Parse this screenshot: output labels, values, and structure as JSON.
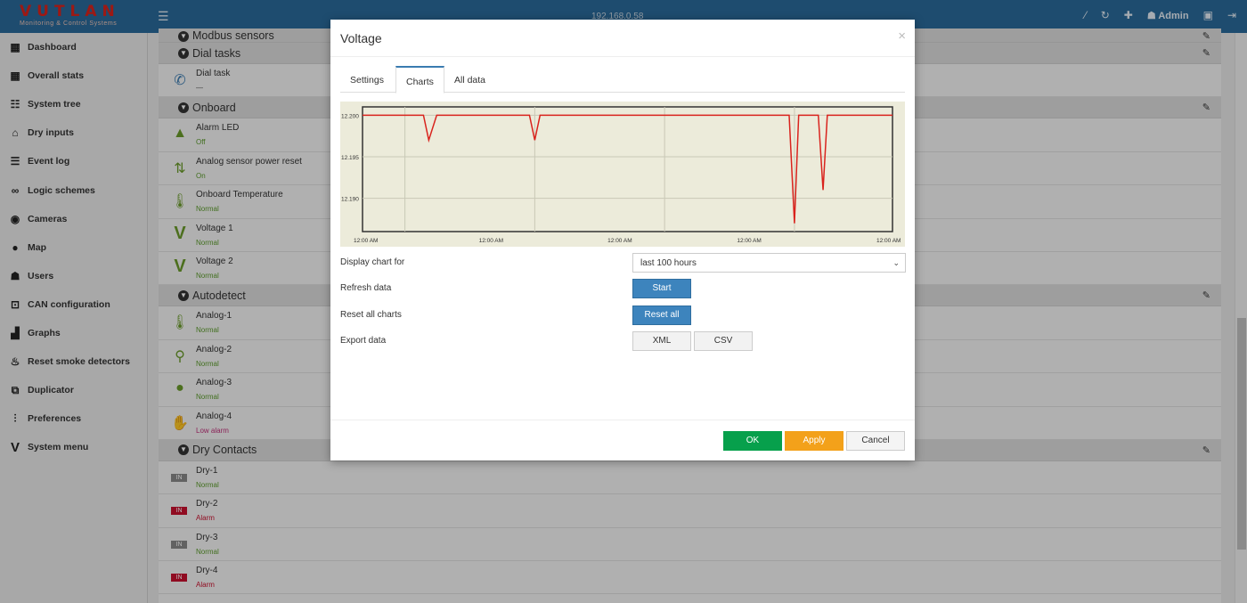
{
  "topbar": {
    "brand": "VUTLAN",
    "brand_sub": "Monitoring & Control Systems",
    "ip": "192.168.0.58",
    "user": "Admin"
  },
  "sidebar": {
    "items": [
      {
        "label": "Dashboard",
        "icon": "grid-icon"
      },
      {
        "label": "Overall stats",
        "icon": "grid-icon"
      },
      {
        "label": "System tree",
        "icon": "tree-icon"
      },
      {
        "label": "Dry inputs",
        "icon": "dry-input-icon"
      },
      {
        "label": "Event log",
        "icon": "list-icon"
      },
      {
        "label": "Logic schemes",
        "icon": "link-icon"
      },
      {
        "label": "Cameras",
        "icon": "eye-icon"
      },
      {
        "label": "Map",
        "icon": "map-marker-icon"
      },
      {
        "label": "Users",
        "icon": "user-icon"
      },
      {
        "label": "CAN configuration",
        "icon": "can-icon"
      },
      {
        "label": "Graphs",
        "icon": "bar-chart-icon"
      },
      {
        "label": "Reset smoke detectors",
        "icon": "fire-icon"
      },
      {
        "label": "Duplicator",
        "icon": "duplicate-icon"
      },
      {
        "label": "Preferences",
        "icon": "sliders-icon"
      },
      {
        "label": "System menu",
        "icon": "vutlan-v-icon"
      }
    ]
  },
  "sections": {
    "modbus": "Modbus sensors",
    "dial": "Dial tasks",
    "dial_rows": [
      {
        "name": "Dial task",
        "status": "—"
      }
    ],
    "onboard": "Onboard",
    "onboard_rows": [
      {
        "name": "Alarm LED",
        "status": "Off"
      },
      {
        "name": "Analog sensor power reset",
        "status": "On"
      },
      {
        "name": "Onboard Temperature",
        "status": "Normal"
      },
      {
        "name": "Voltage 1",
        "status": "Normal"
      },
      {
        "name": "Voltage 2",
        "status": "Normal"
      }
    ],
    "autodetect": "Autodetect",
    "autodetect_rows": [
      {
        "name": "Analog-1",
        "status": "Normal"
      },
      {
        "name": "Analog-2",
        "status": "Normal"
      },
      {
        "name": "Analog-3",
        "status": "Normal"
      },
      {
        "name": "Analog-4",
        "status": "Low alarm"
      }
    ],
    "dry": "Dry Contacts",
    "dry_rows": [
      {
        "name": "Dry-1",
        "status": "Normal",
        "badge": "IN"
      },
      {
        "name": "Dry-2",
        "status": "Alarm",
        "badge": "IN"
      },
      {
        "name": "Dry-3",
        "status": "Normal",
        "badge": "IN"
      },
      {
        "name": "Dry-4",
        "status": "Alarm",
        "badge": "IN"
      }
    ]
  },
  "modal": {
    "title": "Voltage",
    "close": "×",
    "tabs": [
      "Settings",
      "Charts",
      "All data"
    ],
    "active_tab": "Charts",
    "display_label": "Display chart for",
    "display_value": "last 100 hours",
    "refresh_label": "Refresh data",
    "start_label": "Start",
    "reset_label": "Reset all charts",
    "reset_btn": "Reset all",
    "export_label": "Export data",
    "xml_btn": "XML",
    "csv_btn": "CSV",
    "ok": "OK",
    "apply": "Apply",
    "cancel": "Cancel"
  },
  "chart_data": {
    "type": "line",
    "title": "",
    "xlabel": "",
    "ylabel": "",
    "x_ticks": [
      "12:00 AM",
      "12:00 AM",
      "12:00 AM",
      "12:00 AM",
      "12:00 AM"
    ],
    "y_ticks": [
      "12.200",
      "12.195",
      "12.190"
    ],
    "ylim": [
      12.186,
      12.201
    ],
    "grid": true,
    "series": [
      {
        "color": "#d9231d",
        "x": [
          0,
          11.5,
          12.5,
          14,
          31.5,
          32.5,
          33.5,
          80.5,
          81.5,
          82.3,
          83,
          86,
          86.9,
          87.7,
          88.6,
          100
        ],
        "y": [
          12.2,
          12.2,
          12.197,
          12.2,
          12.2,
          12.197,
          12.2,
          12.2,
          12.187,
          12.2,
          12.2,
          12.2,
          12.191,
          12.2,
          12.2,
          12.2
        ]
      }
    ]
  }
}
